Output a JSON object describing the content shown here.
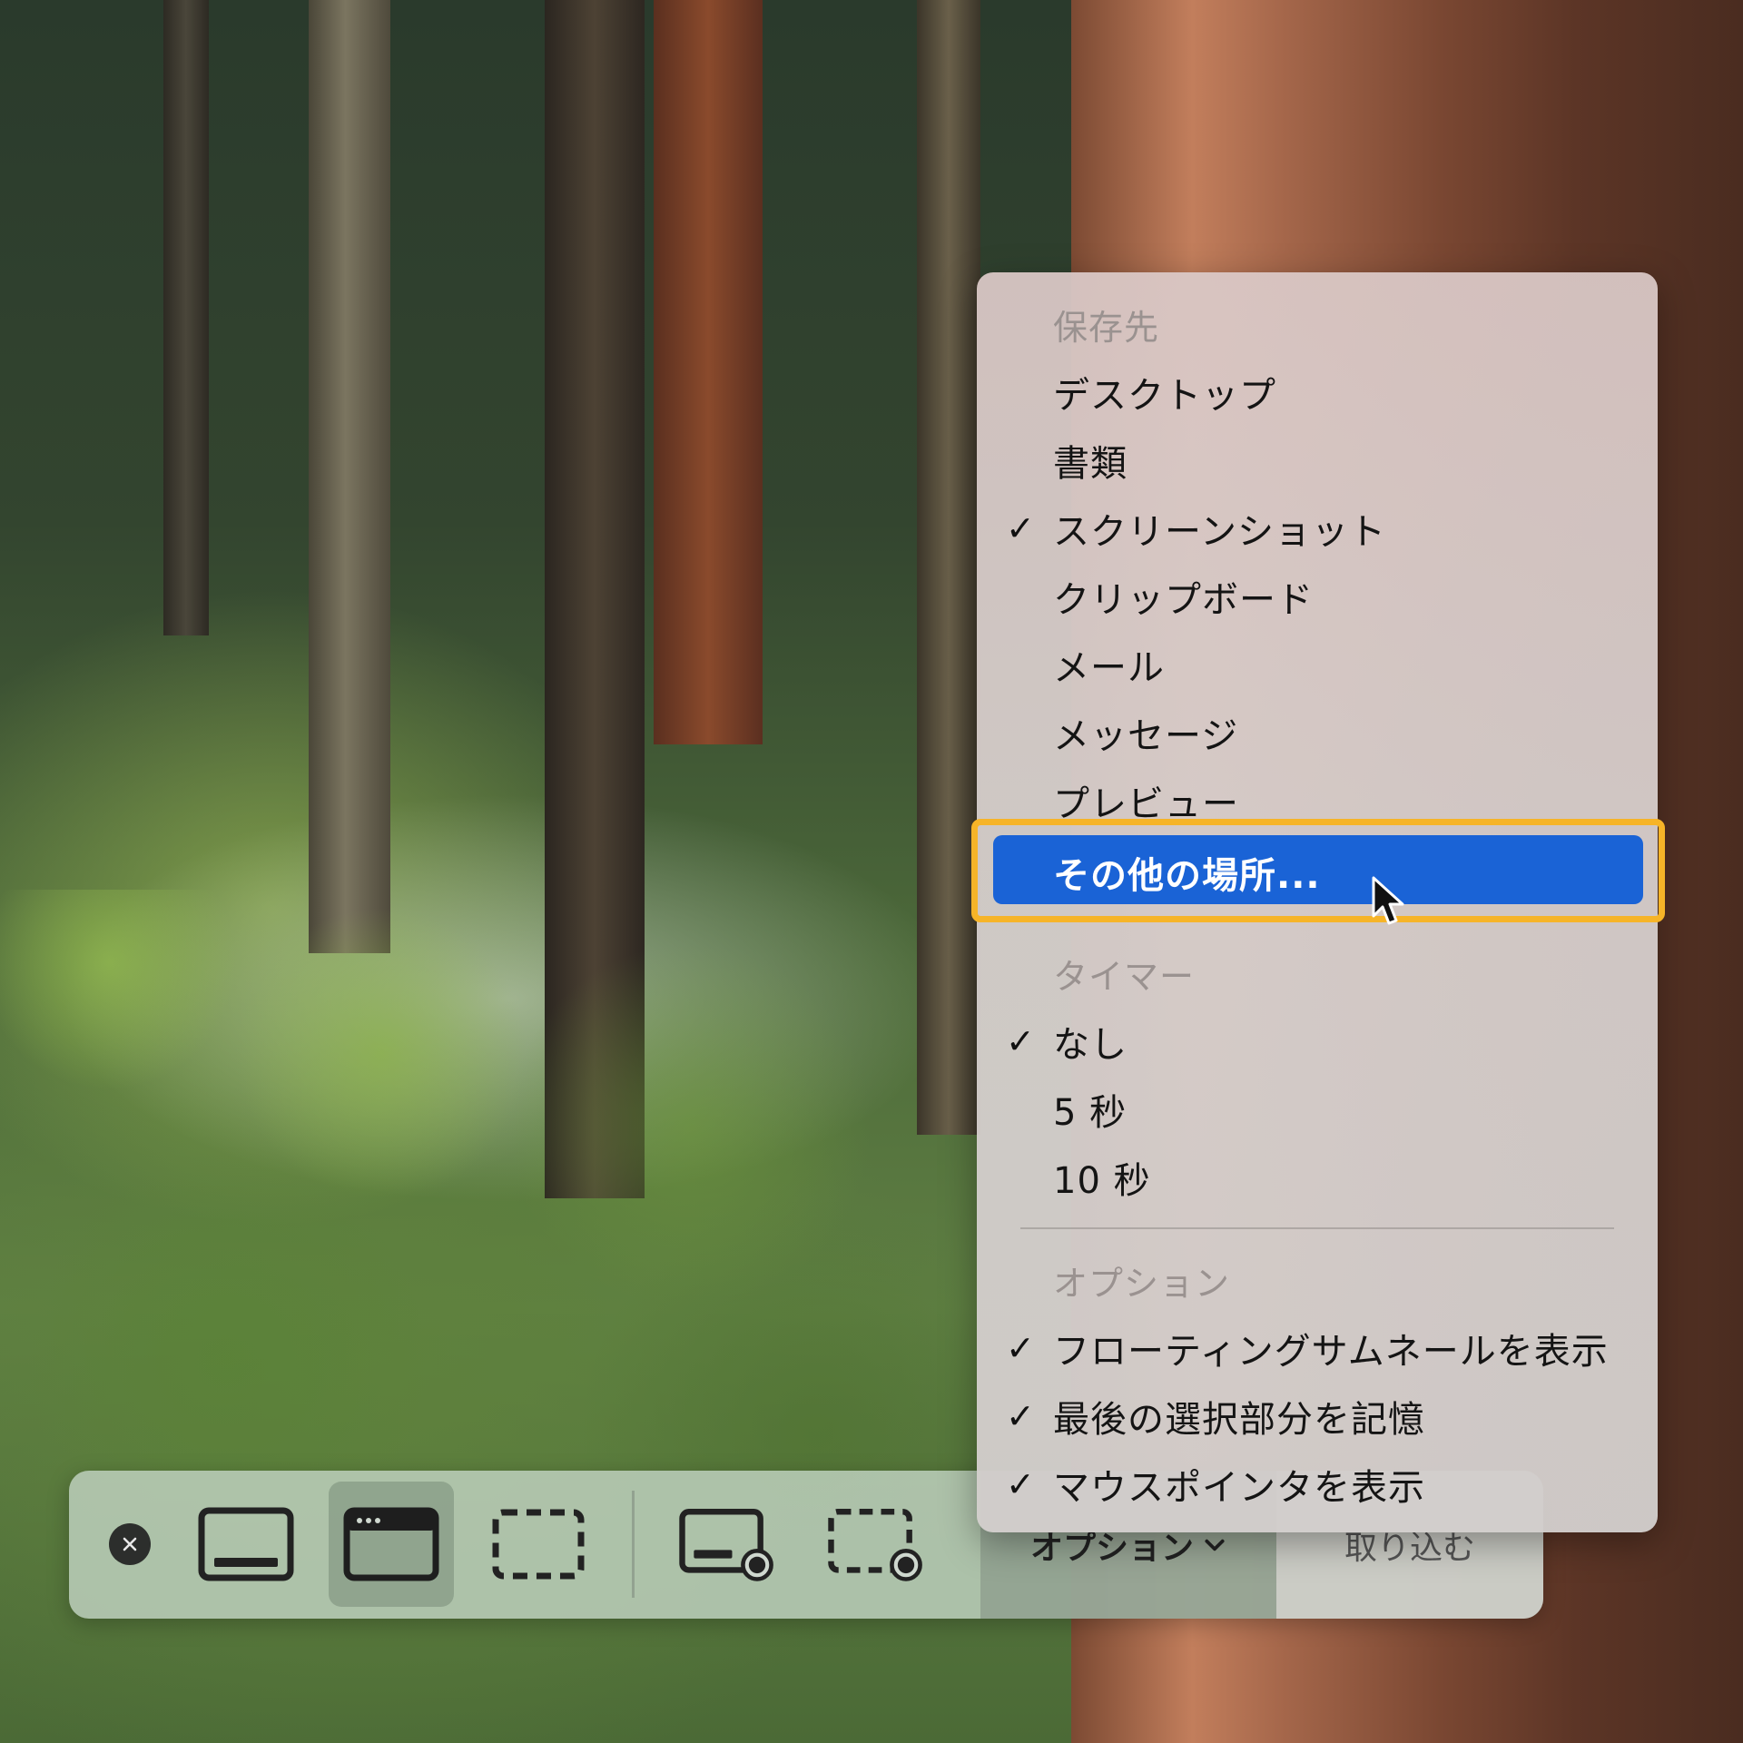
{
  "toolbar": {
    "tools": [
      {
        "name": "capture-entire-screen",
        "icon": "screen-icon"
      },
      {
        "name": "capture-window",
        "icon": "window-icon",
        "selected": true
      },
      {
        "name": "capture-selection",
        "icon": "selection-icon"
      },
      {
        "name": "record-entire-screen",
        "icon": "record-screen-icon"
      },
      {
        "name": "record-selection",
        "icon": "record-selection-icon"
      }
    ],
    "options_label": "オプション",
    "capture_label": "取り込む"
  },
  "menu": {
    "save_to": {
      "header": "保存先",
      "items": [
        {
          "label": "デスクトップ",
          "checked": false
        },
        {
          "label": "書類",
          "checked": false
        },
        {
          "label": "スクリーンショット",
          "checked": true
        },
        {
          "label": "クリップボード",
          "checked": false
        },
        {
          "label": "メール",
          "checked": false
        },
        {
          "label": "メッセージ",
          "checked": false
        },
        {
          "label": "プレビュー",
          "checked": false
        },
        {
          "label": "その他の場所...",
          "checked": false,
          "highlighted": true
        }
      ]
    },
    "timer": {
      "header": "タイマー",
      "items": [
        {
          "label": "なし",
          "checked": true
        },
        {
          "label": "5 秒",
          "checked": false
        },
        {
          "label": "10 秒",
          "checked": false
        }
      ]
    },
    "options": {
      "header": "オプション",
      "items": [
        {
          "label": "フローティングサムネールを表示",
          "checked": true
        },
        {
          "label": "最後の選択部分を記憶",
          "checked": true
        },
        {
          "label": "マウスポインタを表示",
          "checked": true
        }
      ]
    },
    "check_mark": "✓"
  },
  "colors": {
    "highlight": "#1a63d6",
    "annotation_ring": "#f6b428"
  }
}
